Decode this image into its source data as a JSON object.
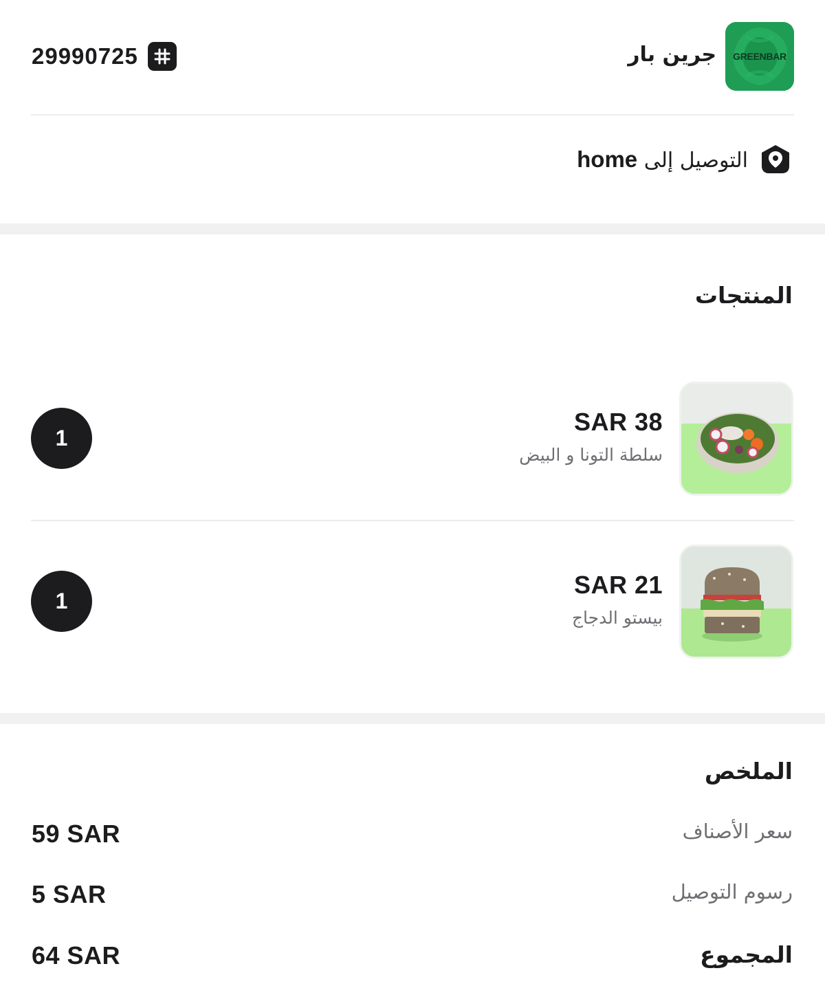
{
  "store": {
    "name": "جرين بار",
    "logo_text": "GREENBAR",
    "brand_color": "#1f9d55"
  },
  "order": {
    "id": "29990725",
    "id_icon": "hash-icon"
  },
  "delivery": {
    "prefix": "التوصيل إلى",
    "destination": "home",
    "icon": "location-pin-icon"
  },
  "products": {
    "title": "المنتجات",
    "items": [
      {
        "price": "SAR 38",
        "name": "سلطة التونا و البيض",
        "quantity": "1",
        "image": "salad-bowl"
      },
      {
        "price": "SAR 21",
        "name": "بيستو الدجاج",
        "quantity": "1",
        "image": "sandwich"
      }
    ]
  },
  "summary": {
    "title": "الملخص",
    "rows": [
      {
        "label": "سعر الأصناف",
        "value": "59 SAR"
      },
      {
        "label": "رسوم التوصيل",
        "value": "5 SAR"
      },
      {
        "label": "المجموع",
        "value": "64 SAR"
      }
    ]
  }
}
